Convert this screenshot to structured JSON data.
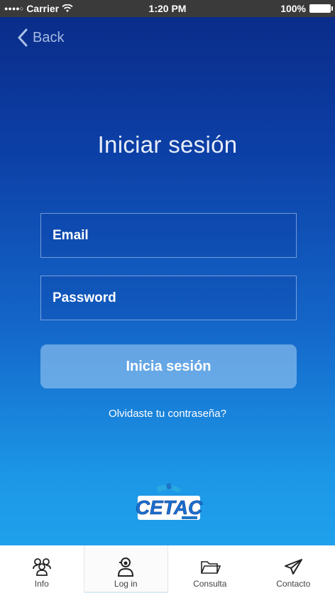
{
  "status_bar": {
    "signal": "●●●●○",
    "carrier": "Carrier",
    "time": "1:20 PM",
    "battery_percent": "100%"
  },
  "nav": {
    "back_label": "Back"
  },
  "login": {
    "title": "Iniciar sesión",
    "email_placeholder": "Email",
    "password_placeholder": "Password",
    "submit_label": "Inicia sesión",
    "forgot_label": "Olvidaste tu contraseña?"
  },
  "logo": {
    "text": "CETAC"
  },
  "tabbar": {
    "selected_index": 1,
    "items": [
      {
        "label": "Info",
        "icon": "people-icon"
      },
      {
        "label": "Log in",
        "icon": "user-headset-icon"
      },
      {
        "label": "Consulta",
        "icon": "folder-icon"
      },
      {
        "label": "Contacto",
        "icon": "send-icon"
      }
    ]
  },
  "colors": {
    "gradient_top": "#0a2a86",
    "gradient_bottom": "#22a9f0",
    "button_fill": "#8cc4ef"
  }
}
